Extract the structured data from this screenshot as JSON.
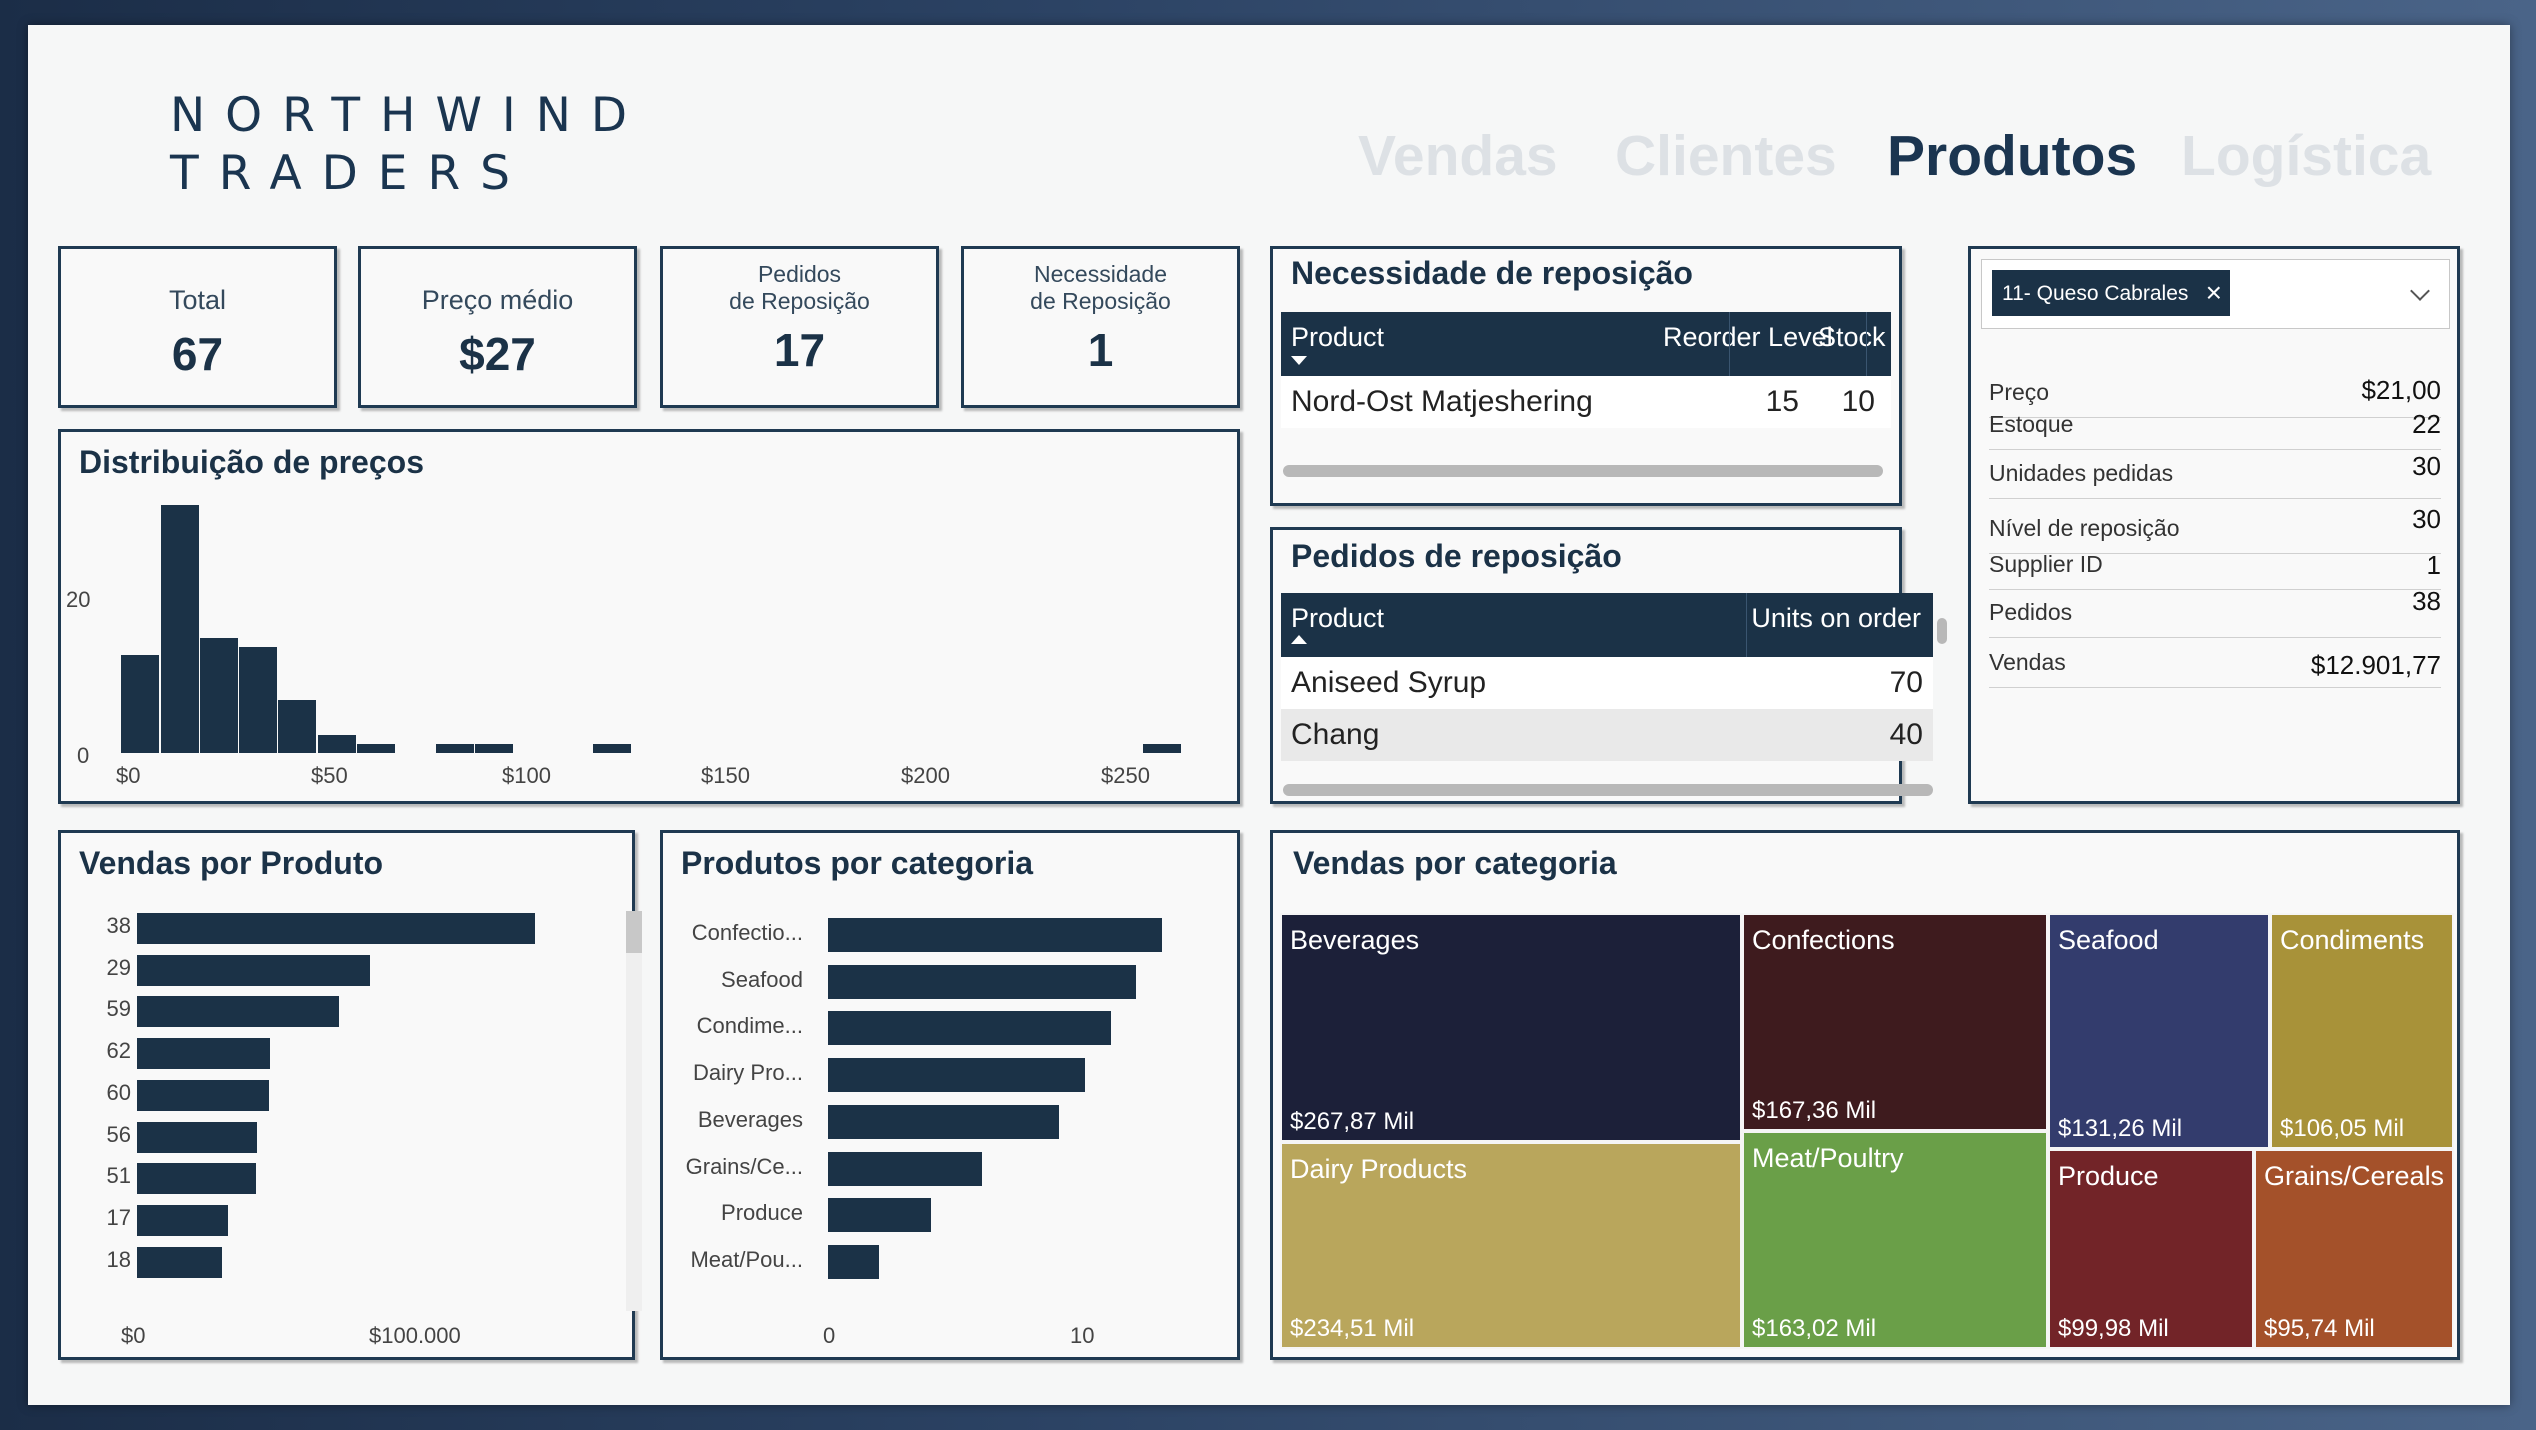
{
  "brand": {
    "line1": "NORTHWIND",
    "line2": "TRADERS"
  },
  "nav": [
    "Vendas",
    "Clientes",
    "Produtos",
    "Logística"
  ],
  "nav_active": "Produtos",
  "kpis": {
    "total": {
      "label": "Total",
      "value": "67"
    },
    "avg_price": {
      "label": "Preço médio",
      "value": "$27"
    },
    "reorder_orders": {
      "label1": "Pedidos",
      "label2": "de Reposição",
      "value": "17"
    },
    "reorder_need": {
      "label1": "Necessidade",
      "label2": "de Reposição",
      "value": "1"
    }
  },
  "price_dist": {
    "title": "Distribuição de preços",
    "y_ticks": [
      "20",
      "0"
    ],
    "x_ticks": [
      "$0",
      "$50",
      "$100",
      "$150",
      "$200",
      "$250"
    ]
  },
  "need_table": {
    "title": "Necessidade de reposição",
    "columns": [
      "Product",
      "Reorder Level",
      "Stock"
    ],
    "rows": [
      {
        "product": "Nord-Ost Matjeshering",
        "reorder_level": "15",
        "stock": "10"
      }
    ]
  },
  "orders_table": {
    "title": "Pedidos de reposição",
    "columns": [
      "Product",
      "Units on order"
    ],
    "rows": [
      {
        "product": "Aniseed Syrup",
        "units": "70"
      },
      {
        "product": "Chang",
        "units": "40"
      }
    ]
  },
  "product_detail": {
    "selected": "11- Queso Cabrales",
    "fields": [
      {
        "label": "Preço",
        "value": "$21,00"
      },
      {
        "label": "Estoque",
        "value": "22"
      },
      {
        "label": "Unidades pedidas",
        "value": "30"
      },
      {
        "label": "Nível de reposição",
        "value": "30"
      },
      {
        "label": "Supplier ID",
        "value": "1"
      },
      {
        "label": "Pedidos",
        "value": "38"
      },
      {
        "label": "Vendas",
        "value": "$12.901,77"
      }
    ]
  },
  "sales_by_product": {
    "title": "Vendas por Produto",
    "x_ticks": [
      "$0",
      "$100.000"
    ]
  },
  "products_by_category": {
    "title": "Produtos por categoria",
    "x_ticks": [
      "0",
      "10"
    ]
  },
  "sales_by_category": {
    "title": "Vendas por categoria",
    "tiles": [
      {
        "name": "Beverages",
        "value": "$267,87 Mil",
        "color": "#1c2039"
      },
      {
        "name": "Dairy Products",
        "value": "$234,51 Mil",
        "color": "#b9a65c"
      },
      {
        "name": "Confections",
        "value": "$167,36 Mil",
        "color": "#3e1b1e"
      },
      {
        "name": "Meat/Poultry",
        "value": "$163,02 Mil",
        "color": "#6a9f48"
      },
      {
        "name": "Seafood",
        "value": "$131,26 Mil",
        "color": "#333c6d"
      },
      {
        "name": "Condiments",
        "value": "$106,05 Mil",
        "color": "#a89239"
      },
      {
        "name": "Produce",
        "value": "$99,98 Mil",
        "color": "#722428"
      },
      {
        "name": "Grains/Cereals",
        "value": "$95,74 Mil",
        "color": "#a4512a"
      }
    ]
  },
  "chart_data": [
    {
      "type": "bar",
      "title": "Distribuição de preços",
      "x": [
        5,
        15,
        25,
        35,
        45,
        55,
        65,
        85,
        95,
        125,
        265
      ],
      "values": [
        11,
        28,
        13,
        12,
        6,
        2,
        1,
        1,
        1,
        1,
        1
      ],
      "xlim": [
        -5,
        275
      ],
      "ylim": [
        0,
        30
      ]
    },
    {
      "type": "bar",
      "title": "Vendas por Produto",
      "categories": [
        "38",
        "29",
        "59",
        "62",
        "60",
        "56",
        "51",
        "17",
        "18"
      ],
      "values": [
        149984,
        87736,
        76296,
        50000,
        49700,
        45100,
        44700,
        34300,
        31900
      ],
      "xlim": [
        0,
        150000
      ]
    },
    {
      "type": "bar",
      "title": "Produtos por categoria",
      "categories": [
        "Confectio...",
        "Seafood",
        "Condime...",
        "Dairy Pro...",
        "Beverages",
        "Grains/Ce...",
        "Produce",
        "Meat/Pou..."
      ],
      "values": [
        13,
        12,
        11,
        10,
        9,
        6,
        4,
        2
      ],
      "xlim": [
        0,
        13
      ]
    }
  ]
}
